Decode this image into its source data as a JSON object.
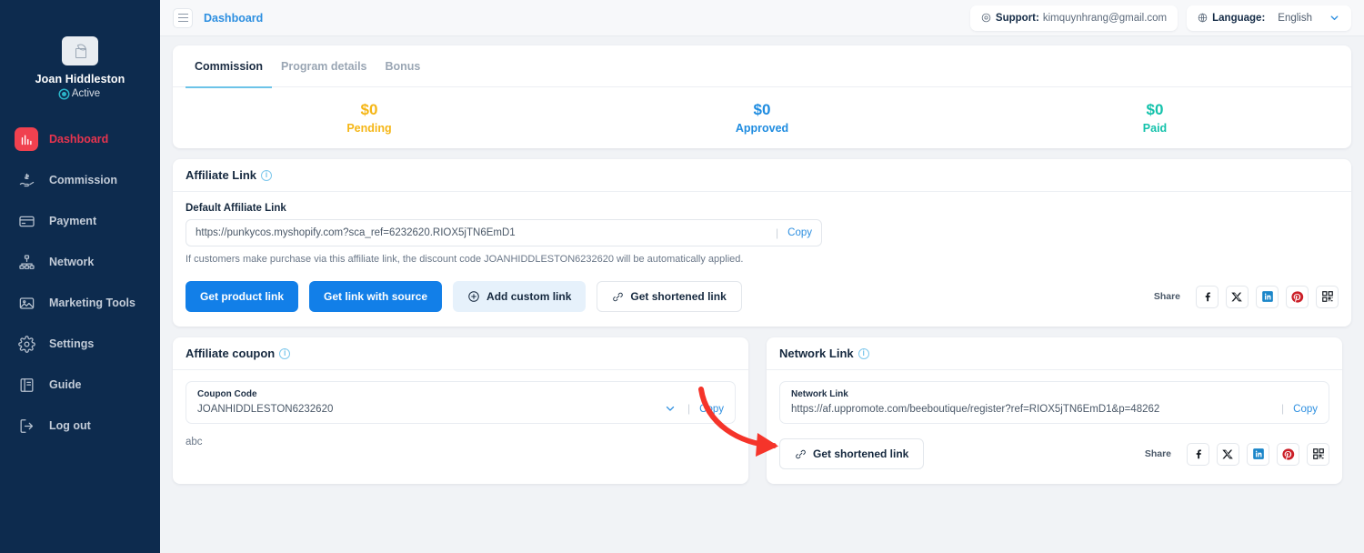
{
  "sidebar": {
    "user": {
      "name": "Joan Hiddleston",
      "status": "Active"
    },
    "items": [
      {
        "label": "Dashboard",
        "icon": "chart-bar-icon",
        "active": true
      },
      {
        "label": "Commission",
        "icon": "hand-coin-icon",
        "active": false
      },
      {
        "label": "Payment",
        "icon": "credit-card-icon",
        "active": false
      },
      {
        "label": "Network",
        "icon": "network-tree-icon",
        "active": false
      },
      {
        "label": "Marketing Tools",
        "icon": "image-icon",
        "active": false
      },
      {
        "label": "Settings",
        "icon": "gear-icon",
        "active": false
      },
      {
        "label": "Guide",
        "icon": "book-icon",
        "active": false
      },
      {
        "label": "Log out",
        "icon": "logout-icon",
        "active": false
      }
    ]
  },
  "topbar": {
    "menu_icon": "hamburger-icon",
    "breadcrumb": "Dashboard",
    "support_label": "Support:",
    "support_email": "kimquynhrang@gmail.com",
    "support_icon": "headset-icon",
    "language_label": "Language:",
    "language_value": "English",
    "language_icon": "globe-icon",
    "language_chevron": "chevron-down-icon"
  },
  "tabs": [
    {
      "label": "Commission",
      "active": true
    },
    {
      "label": "Program details",
      "active": false
    },
    {
      "label": "Bonus",
      "active": false
    }
  ],
  "stats": [
    {
      "amount": "$0",
      "label": "Pending",
      "color": "#f5b616"
    },
    {
      "amount": "$0",
      "label": "Approved",
      "color": "#1f8ce0"
    },
    {
      "amount": "$0",
      "label": "Paid",
      "color": "#14c2ab"
    }
  ],
  "affiliate_link": {
    "title": "Affiliate Link",
    "info_icon": "info-icon",
    "field_label": "Default Affiliate Link",
    "url": "https://punkycos.myshopify.com?sca_ref=6232620.RIOX5jTN6EmD1",
    "copy_label": "Copy",
    "hint": "If customers make purchase via this affiliate link, the discount code JOANHIDDLESTON6232620 will be automatically applied.",
    "buttons": [
      {
        "label": "Get product link",
        "style": "primary",
        "icon": ""
      },
      {
        "label": "Get link with source",
        "style": "primary",
        "icon": ""
      },
      {
        "label": "Add custom link",
        "style": "soft",
        "icon": "plus-circle-icon"
      },
      {
        "label": "Get shortened link",
        "style": "ghost",
        "icon": "link-icon"
      }
    ],
    "share_label": "Share",
    "share_icons": [
      "facebook-icon",
      "x-twitter-icon",
      "linkedin-icon",
      "pinterest-icon",
      "qr-code-icon"
    ]
  },
  "affiliate_coupon": {
    "title": "Affiliate coupon",
    "info_icon": "info-icon",
    "field_label": "Coupon Code",
    "code": "JOANHIDDLESTON6232620",
    "chevron_icon": "chevron-down-icon",
    "copy_label": "Copy",
    "note": "abc"
  },
  "network_link": {
    "title": "Network Link",
    "info_icon": "info-icon",
    "field_label": "Network Link",
    "url": "https://af.uppromote.com/beeboutique/register?ref=RIOX5jTN6EmD1&p=48262",
    "copy_label": "Copy",
    "shorten_button": "Get shortened link",
    "shorten_icon": "link-icon",
    "share_label": "Share",
    "share_icons": [
      "facebook-icon",
      "x-twitter-icon",
      "linkedin-icon",
      "pinterest-icon",
      "qr-code-icon"
    ]
  },
  "annotation": {
    "type": "red-arrow",
    "color": "#f5342a",
    "points_to": "network-link-field"
  },
  "colors": {
    "sidebar_bg": "#0d2b4e",
    "accent_blue": "#127fe8",
    "active_red": "#f0414f",
    "pending": "#f5b616",
    "approved": "#1f8ce0",
    "paid": "#14c2ab"
  }
}
